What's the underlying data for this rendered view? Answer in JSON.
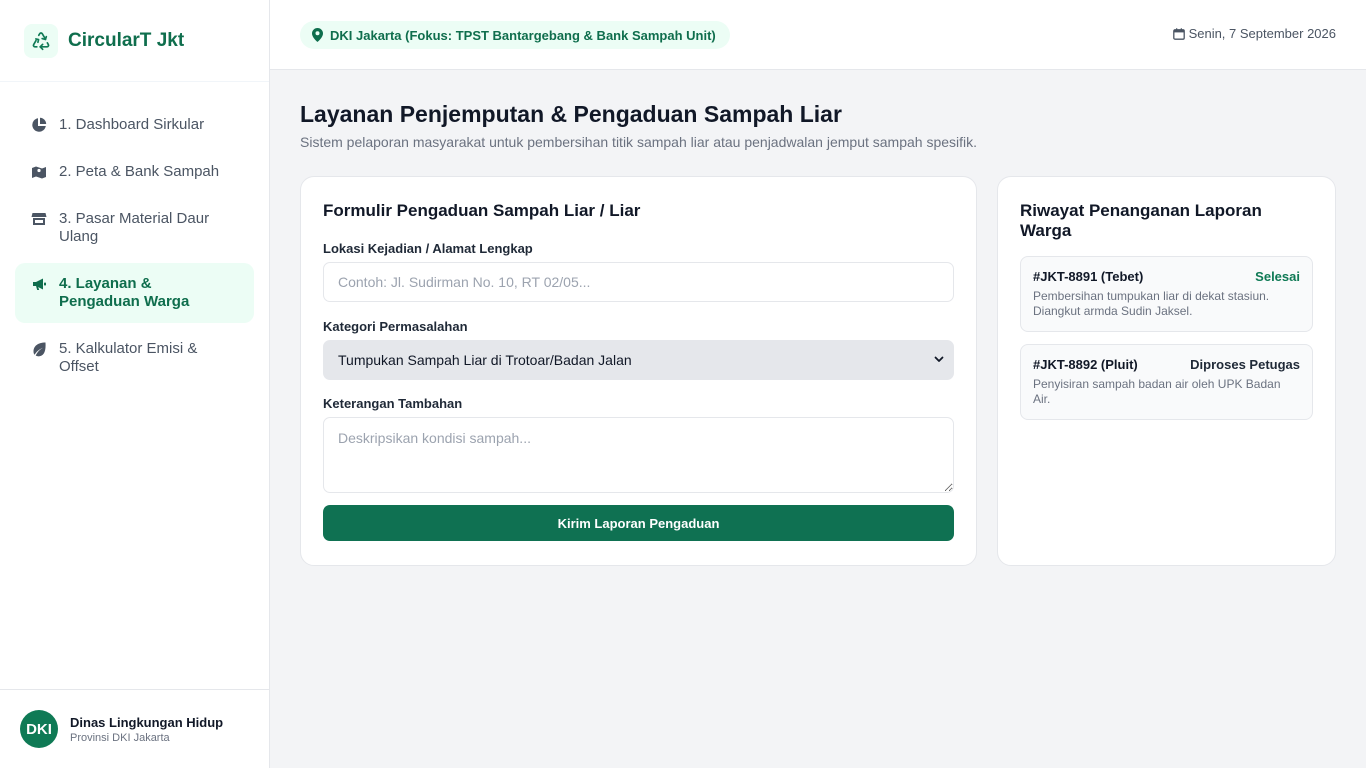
{
  "sidebar": {
    "brand": "CircularT Jkt",
    "items": [
      {
        "label": "1. Dashboard Sirkular",
        "icon": "pie-chart-icon"
      },
      {
        "label": "2. Peta & Bank Sampah",
        "icon": "map-icon"
      },
      {
        "label": "3. Pasar Material Daur Ulang",
        "icon": "store-icon"
      },
      {
        "label": "4. Layanan & Pengaduan Warga",
        "icon": "megaphone-icon",
        "active": true
      },
      {
        "label": "5. Kalkulator Emisi & Offset",
        "icon": "leaf-icon"
      }
    ],
    "user": {
      "avatar": "DKI",
      "name": "Dinas Lingkungan Hidup",
      "subtitle": "Provinsi DKI Jakarta"
    }
  },
  "header": {
    "location": "DKI Jakarta (Fokus: TPST Bantargebang & Bank Sampah Unit)",
    "date": "Senin, 7 September 2026"
  },
  "main": {
    "title": "Layanan Penjemputan & Pengaduan Sampah Liar",
    "subtitle": "Sistem pelaporan masyarakat untuk pembersihan titik sampah liar atau penjadwalan jemput sampah spesifik.",
    "form": {
      "title": "Formulir Pengaduan Sampah Liar / Liar",
      "location_label": "Lokasi Kejadian / Alamat Lengkap",
      "location_placeholder": "Contoh: Jl. Sudirman No. 10, RT 02/05...",
      "category_label": "Kategori Permasalahan",
      "category_value": "Tumpukan Sampah Liar di Trotoar/Badan Jalan",
      "notes_label": "Keterangan Tambahan",
      "notes_placeholder": "Deskripsikan kondisi sampah...",
      "submit_label": "Kirim Laporan Pengaduan"
    },
    "history": {
      "title": "Riwayat Penanganan Laporan Warga",
      "reports": [
        {
          "id": "#JKT-8891 (Tebet)",
          "status": "Selesai",
          "description": "Pembersihan tumpukan liar di dekat stasiun. Diangkut armda Sudin Jaksel."
        },
        {
          "id": "#JKT-8892 (Pluit)",
          "status": "Diproses Petugas",
          "description": "Penyisiran sampah badan air oleh UPK Badan Air."
        }
      ]
    }
  },
  "colors": {
    "accent": "#0f7152",
    "accent_light": "#ecfdf5",
    "status_done": "#0f7a55"
  }
}
